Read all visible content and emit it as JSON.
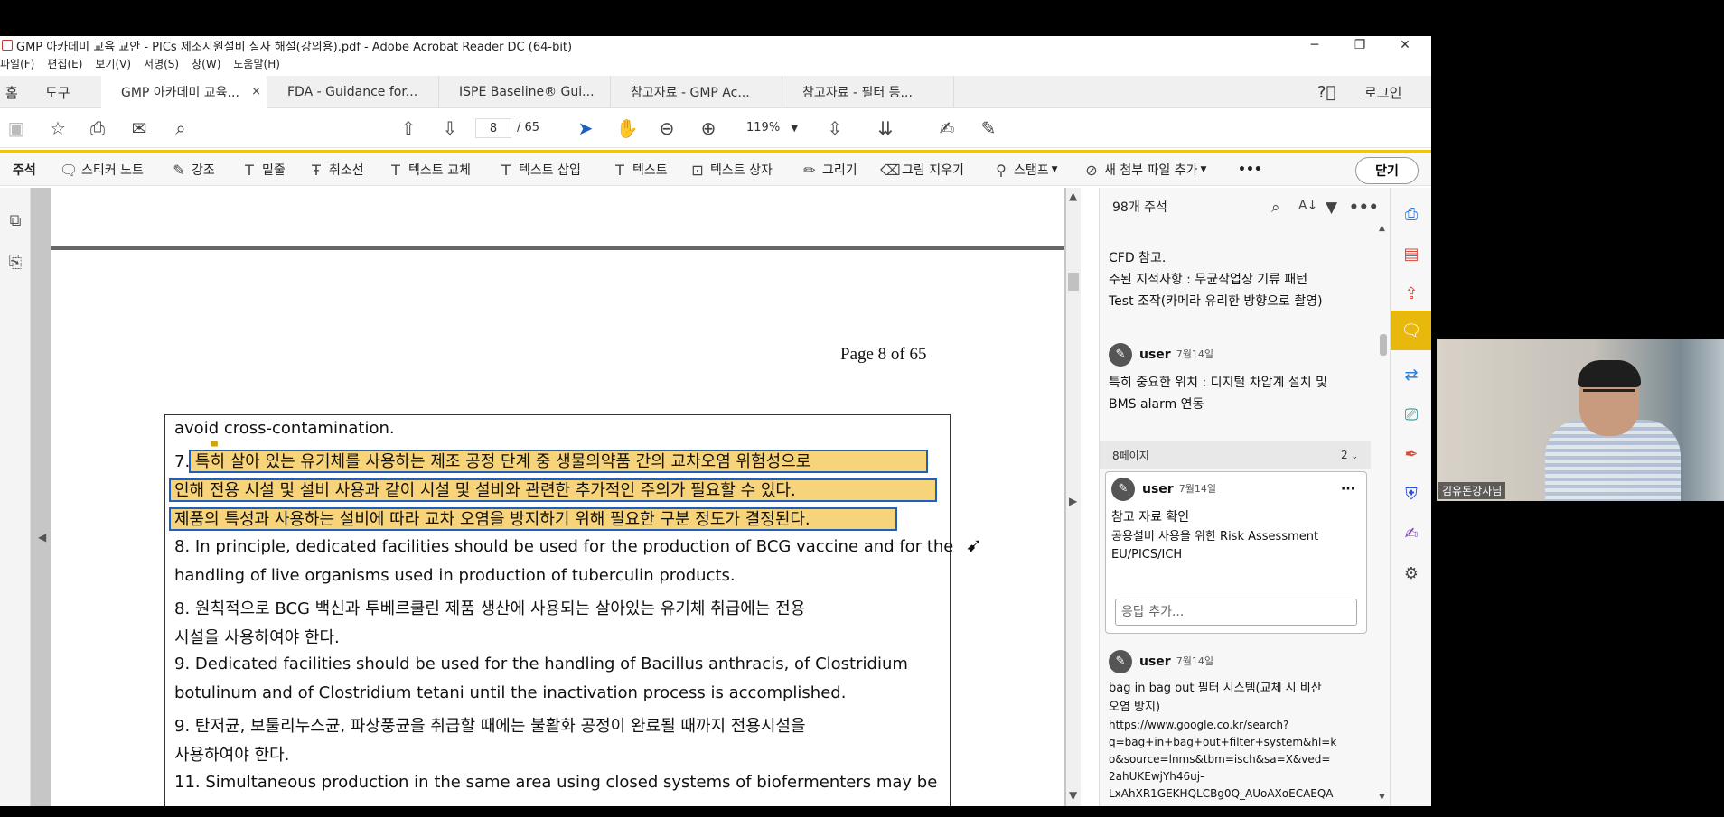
{
  "window": {
    "title": "GMP 아카데미 교육 교안 - PICs 제조지원설비 실사 해설(강의용).pdf - Adobe Acrobat Reader DC (64-bit)",
    "minimize": "─",
    "restore": "❐",
    "close": "✕"
  },
  "menu": [
    "파일(F)",
    "편집(E)",
    "보기(V)",
    "서명(S)",
    "창(W)",
    "도움말(H)"
  ],
  "nav": {
    "home": "홈",
    "tools": "도구",
    "login": "로그인"
  },
  "tabs": [
    {
      "label": "GMP 아카데미 교육...",
      "close": "×"
    },
    {
      "label": "FDA - Guidance for..."
    },
    {
      "label": "ISPE Baseline® Gui..."
    },
    {
      "label": "참고자료 - GMP Ac..."
    },
    {
      "label": "참고자료 - 필터 등..."
    }
  ],
  "toolbar": {
    "page_current": "8",
    "page_total": "/ 65",
    "zoom": "119%"
  },
  "comment_tools": {
    "title": "주석",
    "items": [
      "스티커 노트",
      "강조",
      "밑줄",
      "취소선",
      "텍스트 교체",
      "텍스트 삽입",
      "텍스트",
      "텍스트 상자",
      "그리기",
      "그림 지우기",
      "스탬프",
      "새 첨부 파일 추가"
    ],
    "close": "닫기"
  },
  "document": {
    "page_label": "Page  8  of 65",
    "lines": [
      "avoid cross-contamination.",
      "7. 특히 살아 있는 유기체를 사용하는 제조 공정 단계 중 생물의약품 간의 교차오염 위험성으로",
      "인해 전용 시설 및 설비 사용과 같이 시설 및 설비와 관련한 추가적인 주의가 필요할 수 있다.",
      "제품의 특성과 사용하는 설비에 따라 교차 오염을 방지하기 위해 필요한 구분 정도가 결정된다.",
      "8. In principle, dedicated facilities should be used for the production of BCG vaccine and for the",
      "handling of live organisms used in production of tuberculin products.",
      "8. 원칙적으로 BCG 백신과 투베르쿨린 제품 생산에 사용되는 살아있는 유기체 취급에는 전용",
      "시설을 사용하여야 한다.",
      "9. Dedicated facilities should be used for the handling of Bacillus anthracis, of Clostridium",
      "botulinum and of Clostridium tetani until the inactivation process is accomplished.",
      "9. 탄저균, 보툴리누스균, 파상풍균을 취급할 때에는 불활화 공정이 완료될 때까지 전용시설을",
      "사용하여야 한다.",
      "11. Simultaneous production in the same area using closed systems of biofermenters may be"
    ]
  },
  "comments_panel": {
    "header": "98개 주석",
    "top_text": [
      "CFD 참고.",
      "주된 지적사항 : 무균작업장 기류 패턴",
      "Test 조작(카메라 유리한 방향으로 촬영)"
    ],
    "c1": {
      "user": "user",
      "date": "7월14일",
      "text": [
        "특히 중요한 위치 : 디지털 차압계 설치 및",
        "BMS alarm 연동"
      ]
    },
    "page_sep": {
      "label": "8페이지",
      "count": "2"
    },
    "c2": {
      "user": "user",
      "date": "7월14일",
      "more": "···",
      "text": [
        "참고 자료 확인",
        "공용설비 사용을 위한 Risk Assessment",
        "EU/PICS/ICH"
      ],
      "reply_placeholder": "응답 추가..."
    },
    "c3": {
      "user": "user",
      "date": "7월14일",
      "text": [
        "bag in bag out 필터 시스템(교체 시 비산",
        "오염 방지)",
        "https://www.google.co.kr/search?",
        "q=bag+in+bag+out+filter+system&hl=k",
        "o&source=lnms&tbm=isch&sa=X&ved=",
        "2ahUKEwjYh46uj-",
        "LxAhXR1GEKHQLCBg0Q_AUoAXoECAEQA"
      ]
    }
  },
  "webcam": {
    "label": "김유돈강사님"
  }
}
